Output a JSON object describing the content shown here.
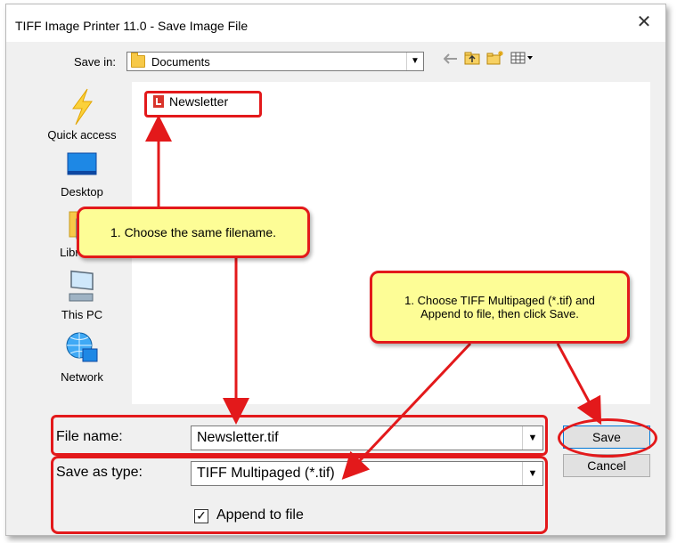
{
  "window": {
    "title": "TIFF Image Printer 11.0 - Save Image File",
    "close_glyph": "✕"
  },
  "toolbar": {
    "save_in_label": "Save in:",
    "save_in_value": "Documents",
    "icons": [
      "back-arrow-icon",
      "up-folder-icon",
      "new-folder-icon",
      "view-menu-icon"
    ]
  },
  "places": [
    {
      "label": "Quick access",
      "icon": "lightning-icon"
    },
    {
      "label": "Desktop",
      "icon": "desktop-icon"
    },
    {
      "label": "Libraries",
      "icon": "libraries-icon"
    },
    {
      "label": "This PC",
      "icon": "computer-icon"
    },
    {
      "label": "Network",
      "icon": "network-icon"
    }
  ],
  "file_list": {
    "items": [
      {
        "name": "Newsletter",
        "icon": "pdf-icon"
      }
    ]
  },
  "form": {
    "file_name_label": "File name:",
    "file_name_value": "Newsletter.tif",
    "save_as_type_label": "Save as type:",
    "save_as_type_value": "TIFF Multipaged (*.tif)",
    "append_label": "Append to file",
    "append_checked": true,
    "checkbox_glyph": "✓"
  },
  "buttons": {
    "save": "Save",
    "cancel": "Cancel"
  },
  "annotations": {
    "callout_filename": "1. Choose the same filename.",
    "callout_type": "1. Choose TIFF Multipaged (*.tif) and Append to file, then click Save.",
    "callout_color": "#fdfd96",
    "highlight_color": "#e3191b"
  }
}
